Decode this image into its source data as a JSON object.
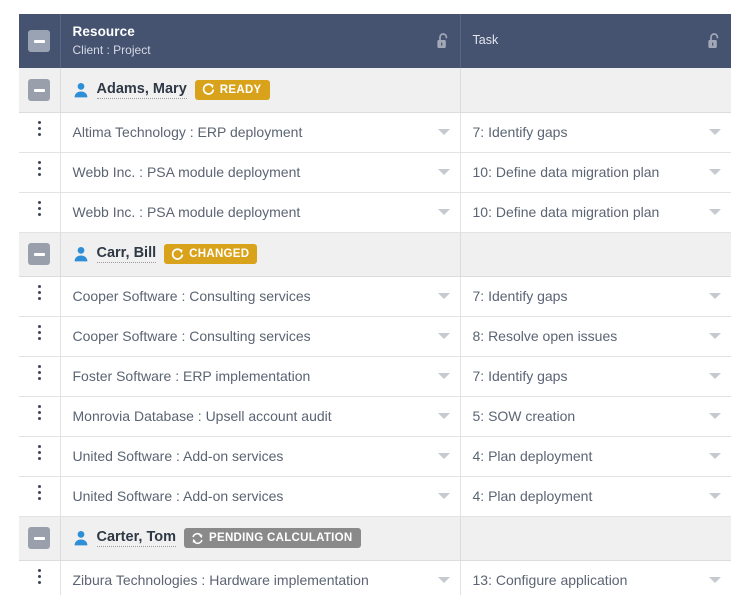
{
  "header": {
    "collapse_icon": "minus-square-icon",
    "resource": {
      "title": "Resource",
      "subtitle": "Client : Project",
      "lock_icon": "unlock-icon"
    },
    "task": {
      "title": "Task",
      "lock_icon": "unlock-icon"
    }
  },
  "colors": {
    "header_bg": "#455270",
    "badge_amber": "#d9a21b",
    "badge_gray": "#8a8a8a",
    "group_row_bg": "#f0f0f0",
    "person_icon": "#2f8fd6",
    "text": "#5b6473"
  },
  "groups": [
    {
      "name": "Adams, Mary",
      "person_icon": "person-icon",
      "collapse_icon": "minus-square-icon",
      "status": {
        "label": "READY",
        "style": "amber",
        "icon": "refresh-icon"
      },
      "rows": [
        {
          "menu_icon": "kebab-menu-icon",
          "resource": "Altima Technology : ERP deployment",
          "task": "7: Identify gaps",
          "caret_icon": "chevron-down-icon"
        },
        {
          "menu_icon": "kebab-menu-icon",
          "resource": "Webb Inc. : PSA module deployment",
          "task": "10: Define data migration plan",
          "caret_icon": "chevron-down-icon"
        },
        {
          "menu_icon": "kebab-menu-icon",
          "resource": "Webb Inc. : PSA module deployment",
          "task": "10: Define data migration plan",
          "caret_icon": "chevron-down-icon"
        }
      ]
    },
    {
      "name": "Carr, Bill",
      "person_icon": "person-icon",
      "collapse_icon": "minus-square-icon",
      "status": {
        "label": "CHANGED",
        "style": "amber",
        "icon": "refresh-icon"
      },
      "rows": [
        {
          "menu_icon": "kebab-menu-icon",
          "resource": "Cooper Software : Consulting services",
          "task": "7: Identify gaps",
          "caret_icon": "chevron-down-icon"
        },
        {
          "menu_icon": "kebab-menu-icon",
          "resource": "Cooper Software : Consulting services",
          "task": "8: Resolve open issues",
          "caret_icon": "chevron-down-icon"
        },
        {
          "menu_icon": "kebab-menu-icon",
          "resource": "Foster Software : ERP implementation",
          "task": "7: Identify gaps",
          "caret_icon": "chevron-down-icon"
        },
        {
          "menu_icon": "kebab-menu-icon",
          "resource": "Monrovia Database : Upsell account audit",
          "task": "5: SOW creation",
          "caret_icon": "chevron-down-icon"
        },
        {
          "menu_icon": "kebab-menu-icon",
          "resource": "United Software : Add-on services",
          "task": "4: Plan deployment",
          "caret_icon": "chevron-down-icon"
        },
        {
          "menu_icon": "kebab-menu-icon",
          "resource": "United Software : Add-on services",
          "task": "4: Plan deployment",
          "caret_icon": "chevron-down-icon"
        }
      ]
    },
    {
      "name": "Carter, Tom",
      "person_icon": "person-icon",
      "collapse_icon": "minus-square-icon",
      "status": {
        "label": "PENDING CALCULATION",
        "style": "gray",
        "icon": "sync-icon"
      },
      "rows": [
        {
          "menu_icon": "kebab-menu-icon",
          "resource": "Zibura Technologies : Hardware implementation",
          "task": "13: Configure application",
          "caret_icon": "chevron-down-icon"
        }
      ]
    }
  ]
}
